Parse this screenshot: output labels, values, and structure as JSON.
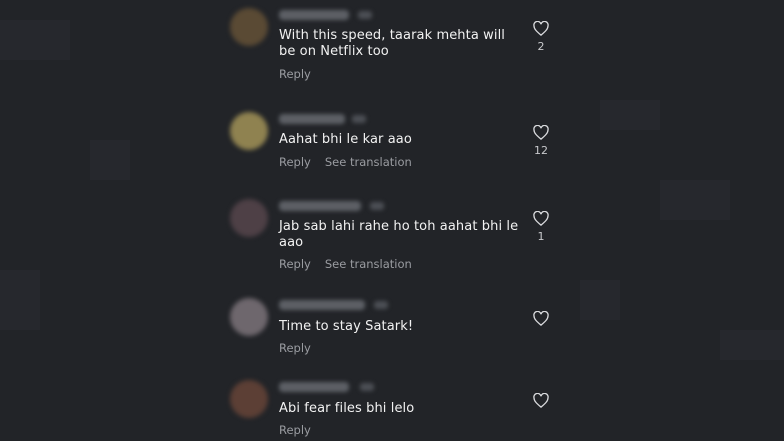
{
  "comments": [
    {
      "text": "With this speed, taarak mehta will be on Netflix too",
      "reply": "Reply",
      "translate": "",
      "likes": "2",
      "avatar_color": "#6b5a3e"
    },
    {
      "text": "Aahat bhi le kar aao",
      "reply": "Reply",
      "translate": "See translation",
      "likes": "12",
      "avatar_color": "#9a8a5a"
    },
    {
      "text": "Jab sab lahi rahe ho toh aahat bhi le aao",
      "reply": "Reply",
      "translate": "See translation",
      "likes": "1",
      "avatar_color": "#5a4a50"
    },
    {
      "text": "Time to stay Satark!",
      "reply": "Reply",
      "translate": "",
      "likes": "",
      "avatar_color": "#7a7278"
    },
    {
      "text": "Abi fear files bhi lelo",
      "reply": "Reply",
      "translate": "",
      "likes": "",
      "avatar_color": "#6a4a3e"
    }
  ],
  "icons": {
    "like": "heart-outline-icon"
  },
  "colors": {
    "background": "#222428",
    "text": "#f2f2f2",
    "secondary": "#9a9ca1"
  }
}
